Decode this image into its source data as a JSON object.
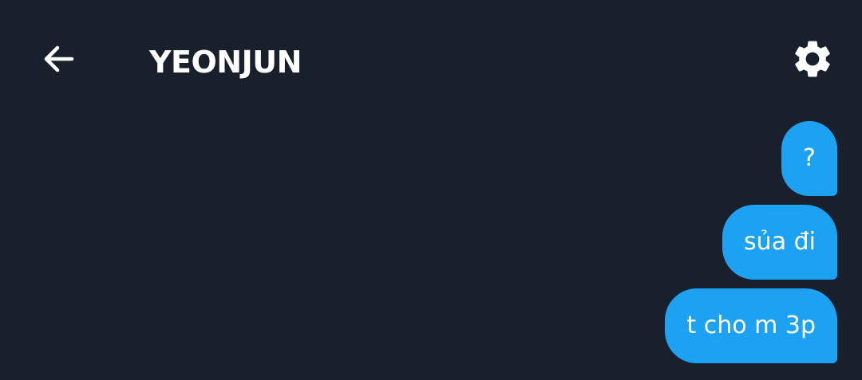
{
  "header": {
    "title": "YEONJUN",
    "back_icon": "arrow-left-icon",
    "settings_icon": "gear-icon"
  },
  "messages": [
    {
      "text": "?"
    },
    {
      "text": "sủa đi"
    },
    {
      "text": "t cho m 3p"
    }
  ],
  "colors": {
    "background": "#18202b",
    "bubble": "#1da1f2",
    "text": "#ffffff"
  }
}
